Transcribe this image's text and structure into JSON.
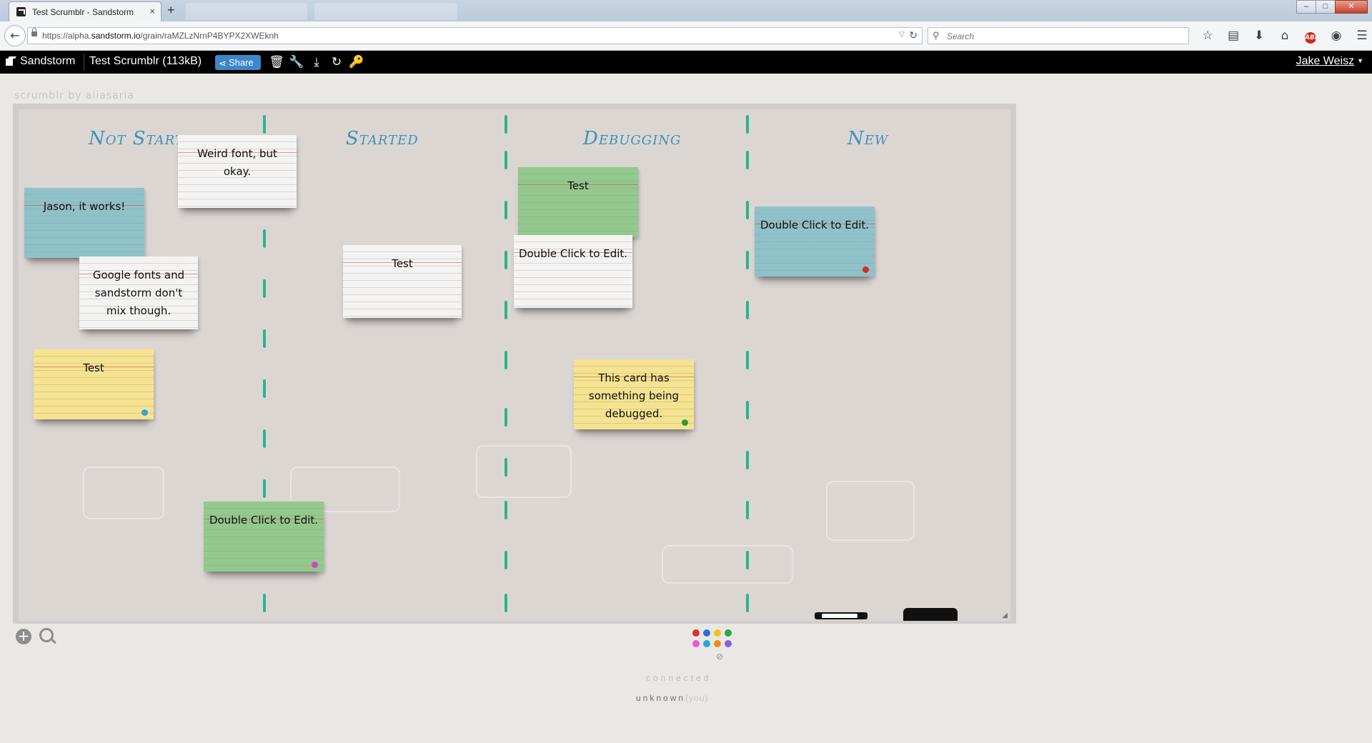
{
  "browser": {
    "tab_title": "Test Scrumblr - Sandstorm",
    "tab_close": "×",
    "new_tab": "+",
    "url_prefix": "https://alpha.",
    "url_domain": "sandstorm.io",
    "url_path": "/grain/raMZLzNrnP4BYPX2XWEknh",
    "search_placeholder": "Search",
    "window_buttons": {
      "minimize": "–",
      "maximize": "□",
      "close": "✕"
    }
  },
  "sandstorm": {
    "brand": "Sandstorm",
    "grain_title": "Test Scrumblr",
    "grain_size": "(113kB)",
    "share_label": "Share",
    "user_name": "Jake Weisz",
    "user_caret": "▼"
  },
  "app": {
    "brand": "scrumblr by aliasaria",
    "columns": [
      "Not Started",
      "Started",
      "Debugging",
      "New"
    ],
    "cards": [
      {
        "text": "Weird font, but okay.",
        "color": "white",
        "dot": null
      },
      {
        "text": "Jason, it works!",
        "color": "blue",
        "dot": null
      },
      {
        "text": "Google fonts and sandstorm don't mix though.",
        "color": "white",
        "dot": null
      },
      {
        "text": "Test",
        "color": "yellow",
        "dot": "#2aa7d6"
      },
      {
        "text": "Double Click to Edit.",
        "color": "green",
        "dot": "#d63fd0"
      },
      {
        "text": "Test",
        "color": "white",
        "dot": null
      },
      {
        "text": "Test",
        "color": "green",
        "dot": null
      },
      {
        "text": "Double Click to Edit.",
        "color": "white",
        "dot": null
      },
      {
        "text": "This card has something being debugged.",
        "color": "yellow",
        "dot": "#2a9a3a"
      },
      {
        "text": "Double Click to Edit.",
        "color": "blue",
        "dot": "#d62828"
      }
    ],
    "palette": [
      "#e02f2f",
      "#2e6fd6",
      "#f0c419",
      "#28a745",
      "#e05bd0",
      "#2aa7d6",
      "#f08a1c",
      "#8a5fd6"
    ],
    "connection_status": "connected",
    "user": "unknown",
    "user_suffix": "(you)"
  }
}
